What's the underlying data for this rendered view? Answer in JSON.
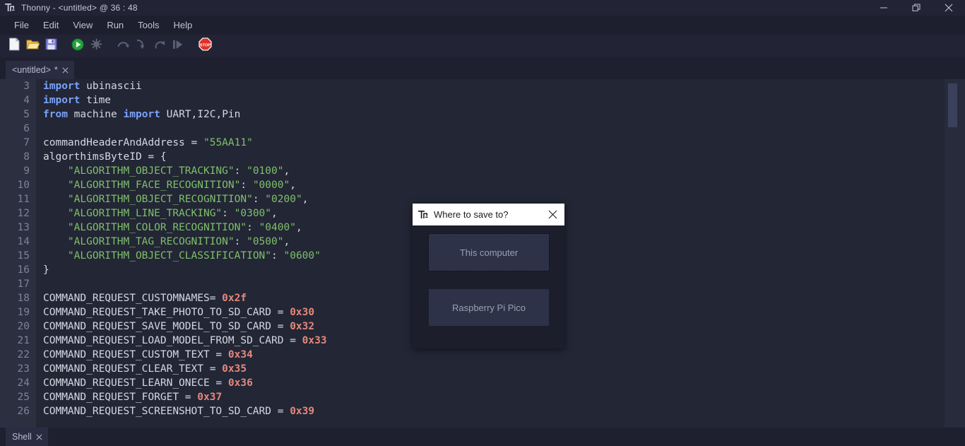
{
  "window": {
    "title": "Thonny  -  <untitled>  @  36 : 48",
    "app_icon": "thonny-logo-icon",
    "controls": [
      {
        "name": "minimize-button",
        "icon": "minimize-icon"
      },
      {
        "name": "restore-button",
        "icon": "restore-icon"
      },
      {
        "name": "close-button",
        "icon": "close-icon"
      }
    ]
  },
  "menubar": {
    "items": [
      {
        "label": "File"
      },
      {
        "label": "Edit"
      },
      {
        "label": "View"
      },
      {
        "label": "Run"
      },
      {
        "label": "Tools"
      },
      {
        "label": "Help"
      }
    ]
  },
  "toolbar": {
    "buttons": [
      {
        "name": "new-file-button",
        "icon": "new-file-icon",
        "enabled": true
      },
      {
        "name": "open-file-button",
        "icon": "open-folder-icon",
        "enabled": true
      },
      {
        "name": "save-file-button",
        "icon": "save-floppy-icon",
        "enabled": true
      },
      {
        "name": "run-button",
        "icon": "run-play-icon",
        "enabled": true
      },
      {
        "name": "debug-button",
        "icon": "debug-bug-icon",
        "enabled": false
      },
      {
        "name": "step-over-button",
        "icon": "step-over-icon",
        "enabled": false
      },
      {
        "name": "step-into-button",
        "icon": "step-into-icon",
        "enabled": false
      },
      {
        "name": "step-out-button",
        "icon": "step-out-icon",
        "enabled": false
      },
      {
        "name": "resume-button",
        "icon": "resume-icon",
        "enabled": false
      },
      {
        "name": "stop-button",
        "icon": "stop-sign-icon",
        "enabled": true
      }
    ]
  },
  "editor_tab": {
    "label": "<untitled>",
    "dirty_marker": "*",
    "close_icon": "close-icon"
  },
  "shell_tab": {
    "label": "Shell",
    "close_icon": "close-icon"
  },
  "editor": {
    "first_line_number": 3,
    "scrollbar": {
      "thumb_top_pct": 1.2,
      "thumb_height_pct": 12.6
    },
    "lines": [
      {
        "n": 3,
        "tokens": [
          {
            "t": "kw",
            "s": "import"
          },
          {
            "t": "def",
            "s": " ubinascii"
          }
        ]
      },
      {
        "n": 4,
        "tokens": [
          {
            "t": "kw",
            "s": "import"
          },
          {
            "t": "def",
            "s": " time"
          }
        ]
      },
      {
        "n": 5,
        "tokens": [
          {
            "t": "kw",
            "s": "from"
          },
          {
            "t": "def",
            "s": " machine "
          },
          {
            "t": "kw",
            "s": "import"
          },
          {
            "t": "def",
            "s": " UART,I2C,Pin"
          }
        ]
      },
      {
        "n": 6,
        "tokens": []
      },
      {
        "n": 7,
        "tokens": [
          {
            "t": "def",
            "s": "commandHeaderAndAddress = "
          },
          {
            "t": "str",
            "s": "\"55AA11\""
          }
        ]
      },
      {
        "n": 8,
        "tokens": [
          {
            "t": "def",
            "s": "algorthimsByteID = {"
          }
        ]
      },
      {
        "n": 9,
        "tokens": [
          {
            "t": "def",
            "s": "    "
          },
          {
            "t": "str",
            "s": "\"ALGORITHM_OBJECT_TRACKING\""
          },
          {
            "t": "def",
            "s": ": "
          },
          {
            "t": "str",
            "s": "\"0100\""
          },
          {
            "t": "def",
            "s": ","
          }
        ]
      },
      {
        "n": 10,
        "tokens": [
          {
            "t": "def",
            "s": "    "
          },
          {
            "t": "str",
            "s": "\"ALGORITHM_FACE_RECOGNITION\""
          },
          {
            "t": "def",
            "s": ": "
          },
          {
            "t": "str",
            "s": "\"0000\""
          },
          {
            "t": "def",
            "s": ","
          }
        ]
      },
      {
        "n": 11,
        "tokens": [
          {
            "t": "def",
            "s": "    "
          },
          {
            "t": "str",
            "s": "\"ALGORITHM_OBJECT_RECOGNITION\""
          },
          {
            "t": "def",
            "s": ": "
          },
          {
            "t": "str",
            "s": "\"0200\""
          },
          {
            "t": "def",
            "s": ","
          }
        ]
      },
      {
        "n": 12,
        "tokens": [
          {
            "t": "def",
            "s": "    "
          },
          {
            "t": "str",
            "s": "\"ALGORITHM_LINE_TRACKING\""
          },
          {
            "t": "def",
            "s": ": "
          },
          {
            "t": "str",
            "s": "\"0300\""
          },
          {
            "t": "def",
            "s": ","
          }
        ]
      },
      {
        "n": 13,
        "tokens": [
          {
            "t": "def",
            "s": "    "
          },
          {
            "t": "str",
            "s": "\"ALGORITHM_COLOR_RECOGNITION\""
          },
          {
            "t": "def",
            "s": ": "
          },
          {
            "t": "str",
            "s": "\"0400\""
          },
          {
            "t": "def",
            "s": ","
          }
        ]
      },
      {
        "n": 14,
        "tokens": [
          {
            "t": "def",
            "s": "    "
          },
          {
            "t": "str",
            "s": "\"ALGORITHM_TAG_RECOGNITION\""
          },
          {
            "t": "def",
            "s": ": "
          },
          {
            "t": "str",
            "s": "\"0500\""
          },
          {
            "t": "def",
            "s": ","
          }
        ]
      },
      {
        "n": 15,
        "tokens": [
          {
            "t": "def",
            "s": "    "
          },
          {
            "t": "str",
            "s": "\"ALGORITHM_OBJECT_CLASSIFICATION\""
          },
          {
            "t": "def",
            "s": ": "
          },
          {
            "t": "str",
            "s": "\"0600\""
          }
        ]
      },
      {
        "n": 16,
        "tokens": [
          {
            "t": "def",
            "s": "}"
          }
        ]
      },
      {
        "n": 17,
        "tokens": []
      },
      {
        "n": 18,
        "tokens": [
          {
            "t": "def",
            "s": "COMMAND_REQUEST_CUSTOMNAMES= "
          },
          {
            "t": "num",
            "s": "0x2f"
          }
        ]
      },
      {
        "n": 19,
        "tokens": [
          {
            "t": "def",
            "s": "COMMAND_REQUEST_TAKE_PHOTO_TO_SD_CARD = "
          },
          {
            "t": "num",
            "s": "0x30"
          }
        ]
      },
      {
        "n": 20,
        "tokens": [
          {
            "t": "def",
            "s": "COMMAND_REQUEST_SAVE_MODEL_TO_SD_CARD = "
          },
          {
            "t": "num",
            "s": "0x32"
          }
        ]
      },
      {
        "n": 21,
        "tokens": [
          {
            "t": "def",
            "s": "COMMAND_REQUEST_LOAD_MODEL_FROM_SD_CARD = "
          },
          {
            "t": "num",
            "s": "0x33"
          }
        ]
      },
      {
        "n": 22,
        "tokens": [
          {
            "t": "def",
            "s": "COMMAND_REQUEST_CUSTOM_TEXT = "
          },
          {
            "t": "num",
            "s": "0x34"
          }
        ]
      },
      {
        "n": 23,
        "tokens": [
          {
            "t": "def",
            "s": "COMMAND_REQUEST_CLEAR_TEXT = "
          },
          {
            "t": "num",
            "s": "0x35"
          }
        ]
      },
      {
        "n": 24,
        "tokens": [
          {
            "t": "def",
            "s": "COMMAND_REQUEST_LEARN_ONECE = "
          },
          {
            "t": "num",
            "s": "0x36"
          }
        ]
      },
      {
        "n": 25,
        "tokens": [
          {
            "t": "def",
            "s": "COMMAND_REQUEST_FORGET = "
          },
          {
            "t": "num",
            "s": "0x37"
          }
        ]
      },
      {
        "n": 26,
        "tokens": [
          {
            "t": "def",
            "s": "COMMAND_REQUEST_SCREENSHOT_TO_SD_CARD = "
          },
          {
            "t": "num",
            "s": "0x39"
          }
        ]
      }
    ]
  },
  "dialog": {
    "title": "Where to save to?",
    "icon": "thonny-logo-icon",
    "close_icon": "close-icon",
    "buttons": [
      {
        "name": "this-computer-button",
        "label": "This computer",
        "focused": true
      },
      {
        "name": "raspberry-pi-pico-button",
        "label": "Raspberry Pi Pico",
        "focused": false
      }
    ]
  },
  "colors": {
    "window_chrome": "#222436",
    "menubar": "#1d1f2e",
    "editor_bg": "#232635",
    "gutter_bg": "#2b2f40",
    "keyword": "#7aa2f7",
    "string": "#7ec06a",
    "number": "#e4887c",
    "text": "#d5d8e2",
    "dialog_title_bg": "#ffffff",
    "dialog_body_bg": "#1c1e2c",
    "dialog_button_bg": "#2e3248",
    "accent_stop": "#d93025"
  }
}
